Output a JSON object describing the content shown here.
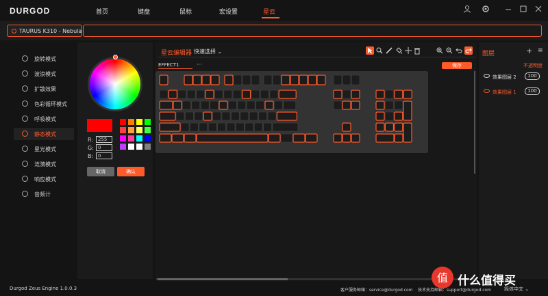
{
  "app": {
    "logo": "DURGOD",
    "version": "Durgod Zeus Engine 1.0.0.3"
  },
  "nav": {
    "items": [
      "首页",
      "键盘",
      "鼠标",
      "宏设置",
      "星云"
    ],
    "active_index": 4
  },
  "device": {
    "name": "TAURUS K310 - Nebula"
  },
  "effects_menu": {
    "items": [
      "旋转模式",
      "波浪模式",
      "扩散效果",
      "色彩循环模式",
      "呼吸模式",
      "静态模式",
      "星光模式",
      "涟漪模式",
      "响应模式",
      "音频计"
    ],
    "active_index": 5
  },
  "color_picker": {
    "current_color": "#ff0000",
    "swatches": [
      "#ff0000",
      "#ff8000",
      "#ffff00",
      "#00ff00",
      "#ff4040",
      "#ffa040",
      "#ffff60",
      "#40ff40",
      "#ff00ff",
      "#ff40a0",
      "#00ffff",
      "#0000ff",
      "#c040ff",
      "#ffffff",
      "#ffffff",
      "#808080"
    ],
    "r_label": "R:",
    "g_label": "G:",
    "b_label": "B:",
    "r": "255",
    "g": "0",
    "b": "0",
    "cancel_label": "取消",
    "ok_label": "确认"
  },
  "editor": {
    "title": "星云编辑器",
    "quick_select": "快速选择",
    "effect_name": "EFFECT1",
    "more": "···",
    "save_label": "保存",
    "tools": [
      "pointer-icon",
      "search-icon",
      "brush-icon",
      "bucket-icon",
      "move-icon",
      "trash-icon",
      "zoom-in-icon",
      "zoom-out-icon",
      "undo-icon",
      "redo-icon"
    ]
  },
  "layers": {
    "title": "图层",
    "opacity_label": "不透明度",
    "items": [
      {
        "name": "效果图层 2",
        "opacity": "100",
        "active": false
      },
      {
        "name": "效果图层 1",
        "opacity": "100",
        "active": true
      }
    ]
  },
  "status": {
    "cs_email": "客户服务邮箱：service@durgod.com",
    "tech_email": "技术支持邮箱：support@durgod.com",
    "language": "简体中文"
  },
  "watermark": {
    "text": "什么值得买"
  },
  "accent_color": "#ff5a2a"
}
